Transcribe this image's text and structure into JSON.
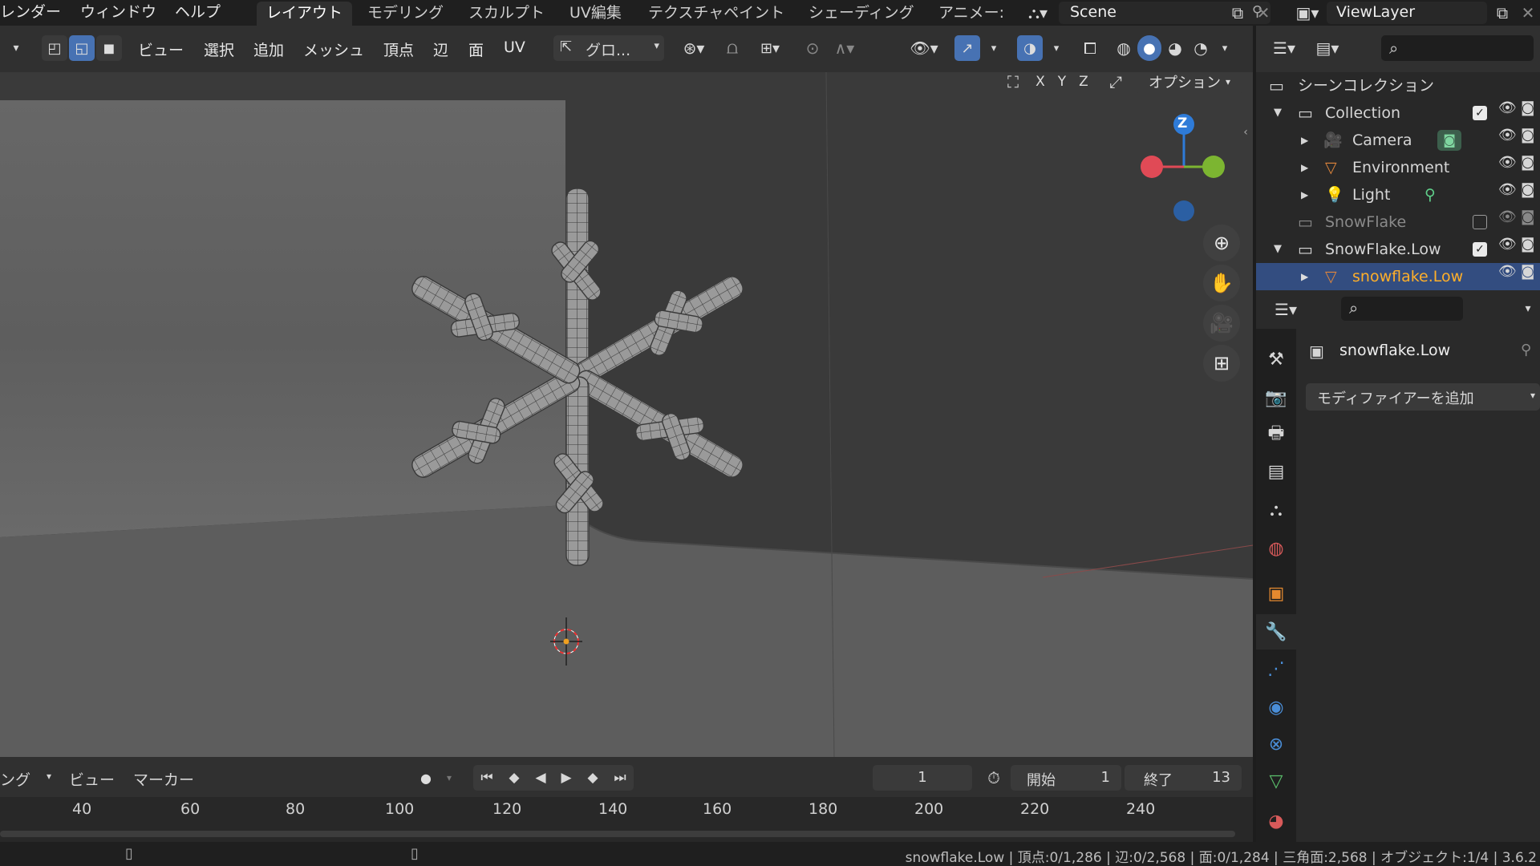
{
  "app": {
    "menus": [
      "レンダー",
      "ウィンドウ",
      "ヘルプ"
    ],
    "workspace_tabs": [
      "レイアウト",
      "モデリング",
      "スカルプト",
      "UV編集",
      "テクスチャペイント",
      "シェーディング",
      "アニメー:"
    ],
    "active_tab": "レイアウト",
    "scene_name": "Scene",
    "view_layer_name": "ViewLayer"
  },
  "viewport_header": {
    "menus": [
      "ビュー",
      "選択",
      "追加",
      "メッシュ",
      "頂点",
      "辺",
      "面",
      "UV"
    ],
    "transform_orientation": "グロ...",
    "axes": [
      "X",
      "Y",
      "Z"
    ],
    "options_label": "オプション"
  },
  "gizmo": {
    "z_label": "Z",
    "colors": {
      "x": "#e04a56",
      "y": "#7cb531",
      "z": "#2e7bd8"
    }
  },
  "outliner": {
    "title": "シーンコレクション",
    "items": [
      {
        "label": "Collection",
        "type": "collection",
        "depth": 0,
        "checked": true
      },
      {
        "label": "Camera",
        "type": "camera",
        "depth": 1
      },
      {
        "label": "Environment",
        "type": "mesh",
        "depth": 1
      },
      {
        "label": "Light",
        "type": "light",
        "depth": 1
      },
      {
        "label": "SnowFlake",
        "type": "collection",
        "depth": 0,
        "checked": false,
        "dim": true
      },
      {
        "label": "SnowFlake.Low",
        "type": "collection",
        "depth": 0,
        "checked": true
      },
      {
        "label": "snowflake.Low",
        "type": "mesh",
        "depth": 1,
        "selected": true
      }
    ]
  },
  "properties": {
    "object_name": "snowflake.Low",
    "add_modifier_label": "モディファイアーを追加"
  },
  "timeline": {
    "mode_label": "ング",
    "menus": [
      "ビュー",
      "マーカー"
    ],
    "current_frame": "1",
    "start_label": "開始",
    "start_value": "1",
    "end_label": "終了",
    "end_value": "13",
    "ticks": [
      "40",
      "60",
      "80",
      "100",
      "120",
      "140",
      "160",
      "180",
      "200",
      "220",
      "240"
    ]
  },
  "status_bar": "snowflake.Low | 頂点:0/1,286 | 辺:0/2,568 | 面:0/1,284 | 三角面:2,568 | オブジェクト:1/4 | 3.6.2"
}
